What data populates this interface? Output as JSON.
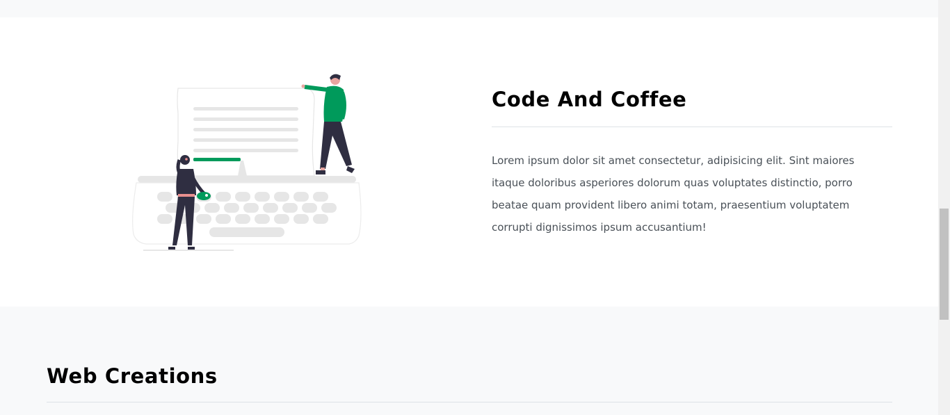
{
  "about": {
    "title": "Code And Coffee",
    "text": "Lorem ipsum dolor sit amet consectetur, adipisicing elit. Sint maiores itaque doloribus asperiores dolorum quas voluptates distinctio, porro beatae quam provident libero animi totam, praesentium voluptatem corrupti dignissimos ipsum accusantium!",
    "illustration_icon": "typewriter-people-illustration"
  },
  "web": {
    "title": "Web Creations"
  },
  "colors": {
    "accent": "#009a5b",
    "section_alt_bg": "#f8f9fa",
    "text": "#495057",
    "heading": "#000000"
  }
}
